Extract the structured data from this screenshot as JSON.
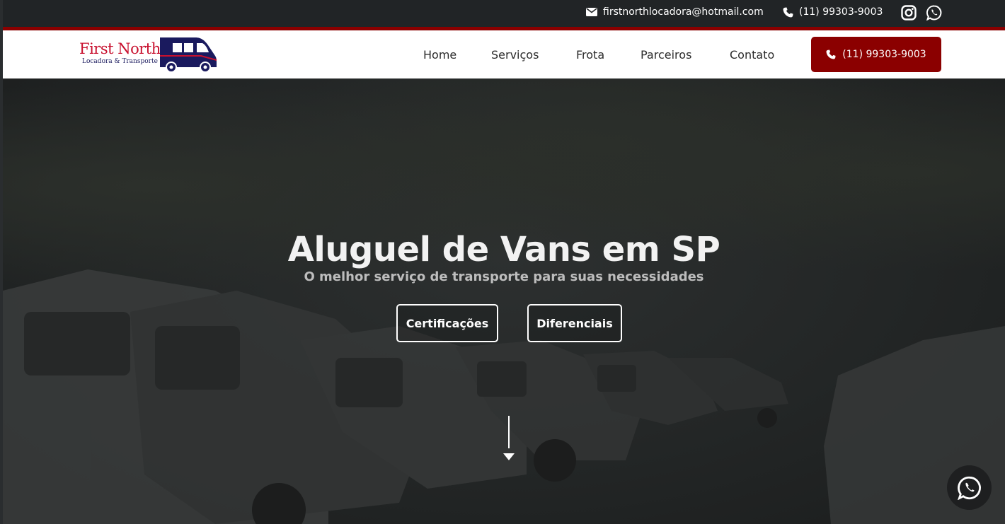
{
  "topbar": {
    "email": "firstnorthlocadora@hotmail.com",
    "phone": "(11) 99303-9003",
    "icons": [
      "envelope-icon",
      "phone-icon",
      "instagram-icon",
      "whatsapp-icon"
    ]
  },
  "logo": {
    "brand": "First North",
    "tagline": "Locadora & Transporte"
  },
  "nav": {
    "home": "Home",
    "services": "Serviços",
    "fleet": "Frota",
    "partners": "Parceiros",
    "contact": "Contato"
  },
  "header_cta": {
    "label": "(11) 99303-9003"
  },
  "hero": {
    "title": "Aluguel de Vans em SP",
    "subtitle": "O melhor serviço de transporte para suas necessidades",
    "button_certifications": "Certificações",
    "button_differentials": "Diferenciais"
  },
  "colors": {
    "accent_red": "#8b0000",
    "brand_red": "#c8102e",
    "brand_navy": "#1a1a5e",
    "topbar_bg": "#212426"
  }
}
